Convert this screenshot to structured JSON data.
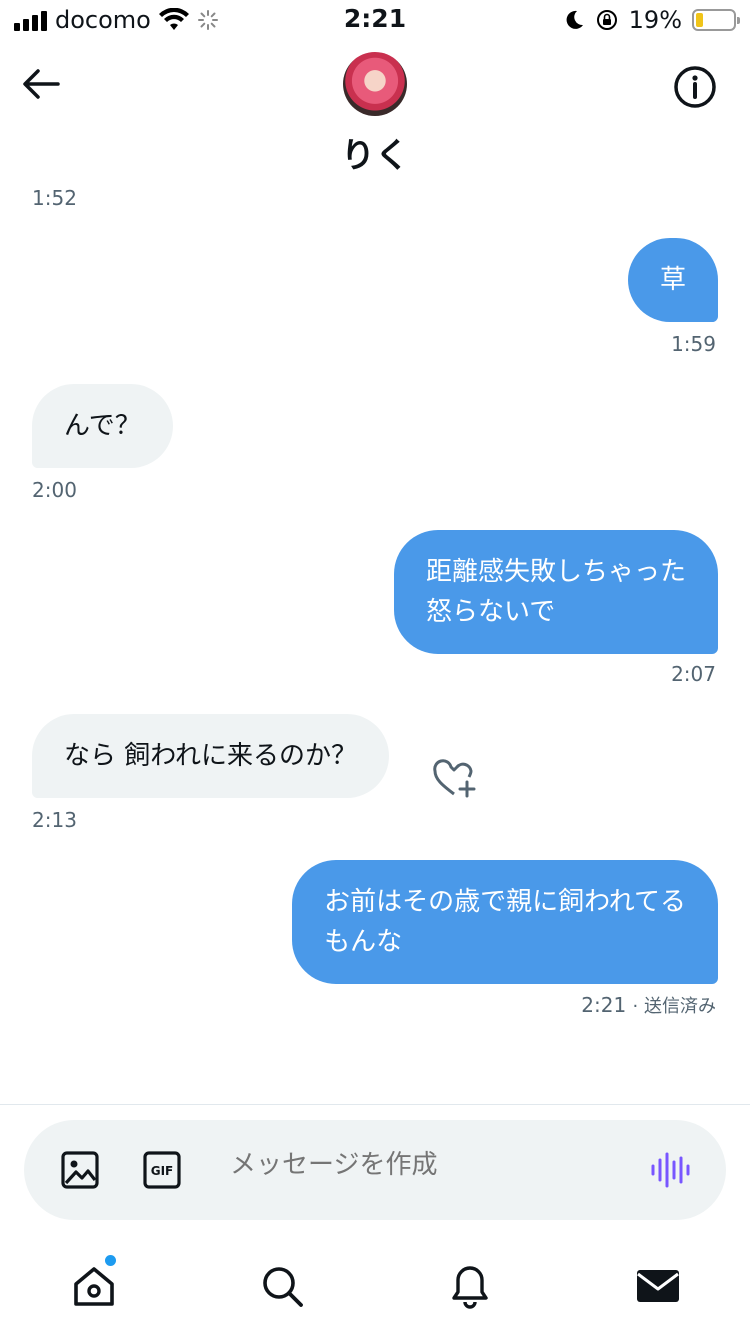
{
  "status_bar": {
    "carrier": "docomo",
    "time": "2:21",
    "battery": "19%"
  },
  "header": {
    "name": "りく",
    "avatar": "avatar"
  },
  "messages": [
    {
      "time": "1:52"
    },
    {
      "direction": "out",
      "lines": [
        "草"
      ],
      "time": "1:59"
    },
    {
      "direction": "in",
      "lines": [
        "んで？"
      ],
      "time": "2:00"
    },
    {
      "direction": "out",
      "lines": [
        "距離感失敗しちゃった",
        "怒らないで"
      ],
      "time": "2:07"
    },
    {
      "direction": "in",
      "lines": [
        "なら 飼われに来るのか？"
      ],
      "time": "2:13"
    },
    {
      "direction": "out",
      "lines": [
        "お前はその歳で親に飼われてる",
        "もんな"
      ],
      "time": "2:21",
      "status": "· 送信済み"
    }
  ],
  "composer": {
    "placeholder": "メッセージを作成"
  },
  "icons": {
    "back": "arrow-left-icon",
    "info": "info-icon",
    "like": "heart-plus-icon",
    "image": "image-icon",
    "gif": "gif-icon",
    "voice": "voice-wave-icon",
    "home": "home-icon",
    "search": "search-icon",
    "notifications": "bell-icon",
    "messages": "envelope-icon"
  },
  "colors": {
    "accent": "#1d9bf0",
    "outgoing_bubble": "#4a99e9",
    "incoming_bubble": "#eff3f4",
    "voice": "#7856ff",
    "battery": "#f0c419"
  }
}
